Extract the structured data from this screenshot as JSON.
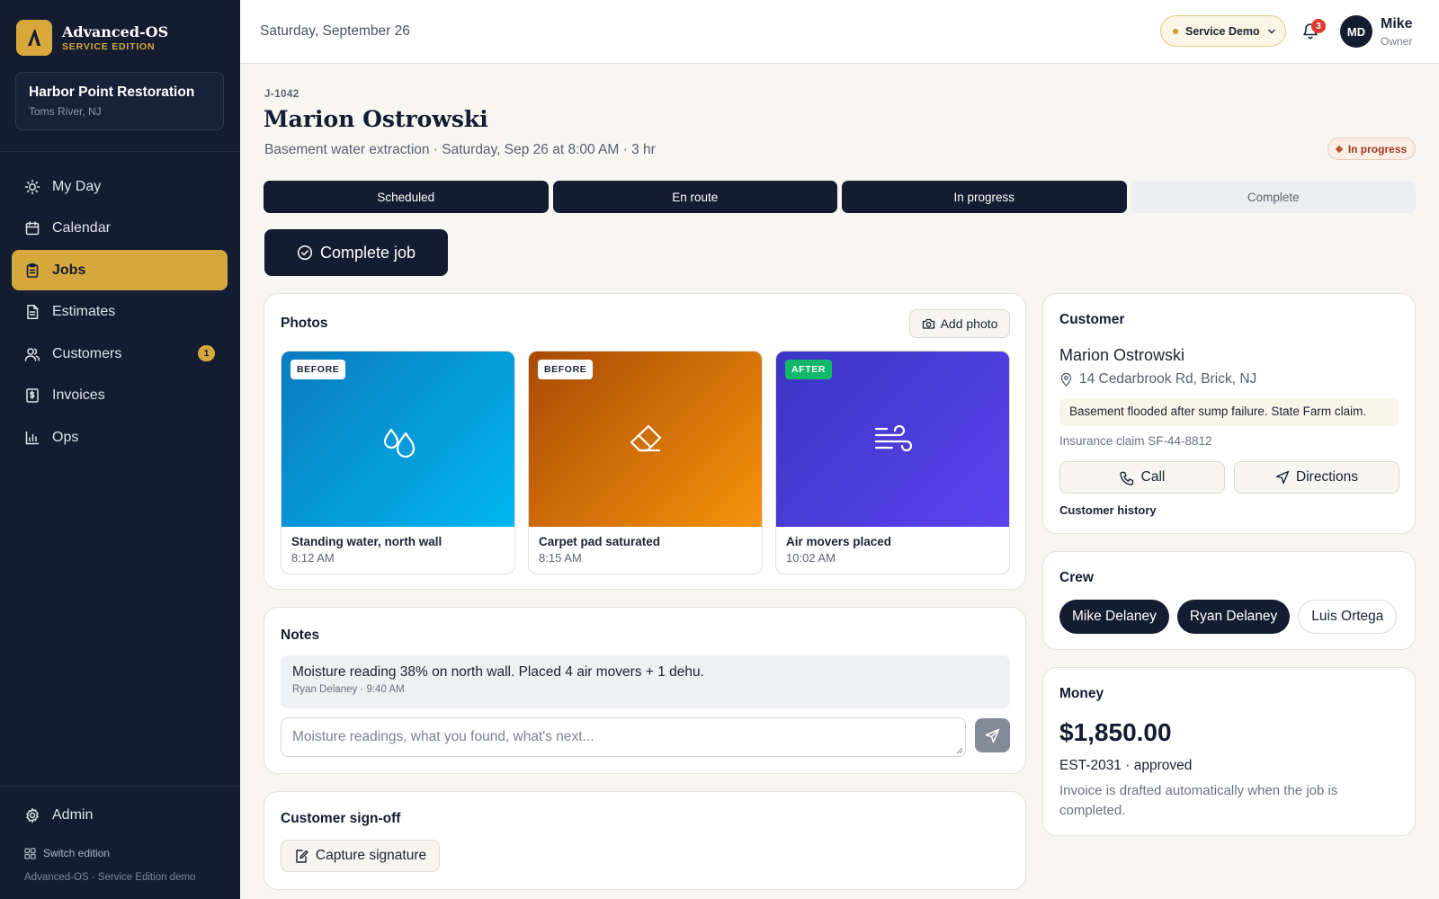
{
  "brand": {
    "name": "Advanced-OS",
    "edition": "SERVICE EDITION"
  },
  "org": {
    "name": "Harbor Point Restoration",
    "location": "Toms River, NJ"
  },
  "nav": {
    "items": [
      {
        "label": "My Day",
        "icon": "sun-icon"
      },
      {
        "label": "Calendar",
        "icon": "calendar-icon"
      },
      {
        "label": "Jobs",
        "icon": "clipboard-icon",
        "active": true
      },
      {
        "label": "Estimates",
        "icon": "document-icon"
      },
      {
        "label": "Customers",
        "icon": "users-icon",
        "badge": "1"
      },
      {
        "label": "Invoices",
        "icon": "invoice-icon"
      },
      {
        "label": "Ops",
        "icon": "bar-chart-icon"
      }
    ],
    "admin_label": "Admin",
    "switch_label": "Switch edition",
    "footer": "Advanced-OS · Service Edition demo"
  },
  "topbar": {
    "date": "Saturday, September 26",
    "demo_label": "Service Demo",
    "notification_count": "3",
    "user_initials": "MD",
    "user_name": "Mike",
    "user_role": "Owner"
  },
  "job": {
    "id": "J-1042",
    "customer": "Marion Ostrowski",
    "meta": "Basement water extraction · Saturday, Sep 26 at 8:00 AM · 3 hr",
    "status": "In progress",
    "steps": [
      {
        "label": "Scheduled",
        "done": true
      },
      {
        "label": "En route",
        "done": true
      },
      {
        "label": "In progress",
        "done": true
      },
      {
        "label": "Complete",
        "done": false
      }
    ],
    "complete_button": "Complete job"
  },
  "photos": {
    "title": "Photos",
    "add_label": "Add photo",
    "items": [
      {
        "tag": "BEFORE",
        "caption": "Standing water, north wall",
        "time": "8:12 AM",
        "icon": "water-drops-icon",
        "gradient": [
          "#0a7bbf",
          "#00b6f0"
        ]
      },
      {
        "tag": "BEFORE",
        "caption": "Carpet pad saturated",
        "time": "8:15 AM",
        "icon": "eraser-icon",
        "gradient": [
          "#a84a04",
          "#f7930b"
        ]
      },
      {
        "tag": "AFTER",
        "caption": "Air movers placed",
        "time": "10:02 AM",
        "icon": "wind-icon",
        "gradient": [
          "#3a35c4",
          "#5b43ee"
        ]
      }
    ]
  },
  "notes": {
    "title": "Notes",
    "entry_text": "Moisture reading 38% on north wall. Placed 4 air movers + 1 dehu.",
    "entry_meta": "Ryan Delaney · 9:40 AM",
    "input_placeholder": "Moisture readings, what you found, what's next..."
  },
  "signoff": {
    "title": "Customer sign-off",
    "button": "Capture signature"
  },
  "customer": {
    "title": "Customer",
    "name": "Marion Ostrowski",
    "address": "14 Cedarbrook Rd, Brick, NJ",
    "note": "Basement flooded after sump failure. State Farm claim.",
    "claim": "Insurance claim SF-44-8812",
    "call_label": "Call",
    "directions_label": "Directions",
    "history_label": "Customer history"
  },
  "crew": {
    "title": "Crew",
    "members": [
      {
        "name": "Mike Delaney",
        "assigned": true
      },
      {
        "name": "Ryan Delaney",
        "assigned": true
      },
      {
        "name": "Luis Ortega",
        "assigned": false
      }
    ]
  },
  "money": {
    "title": "Money",
    "amount": "$1,850.00",
    "estimate": "EST-2031 · approved",
    "note": "Invoice is drafted automatically when the job is completed."
  },
  "colors": {
    "navy": "#141c31",
    "gold": "#d4a83c",
    "status": "#9a3b1e",
    "after_tag": "#12b76a"
  }
}
